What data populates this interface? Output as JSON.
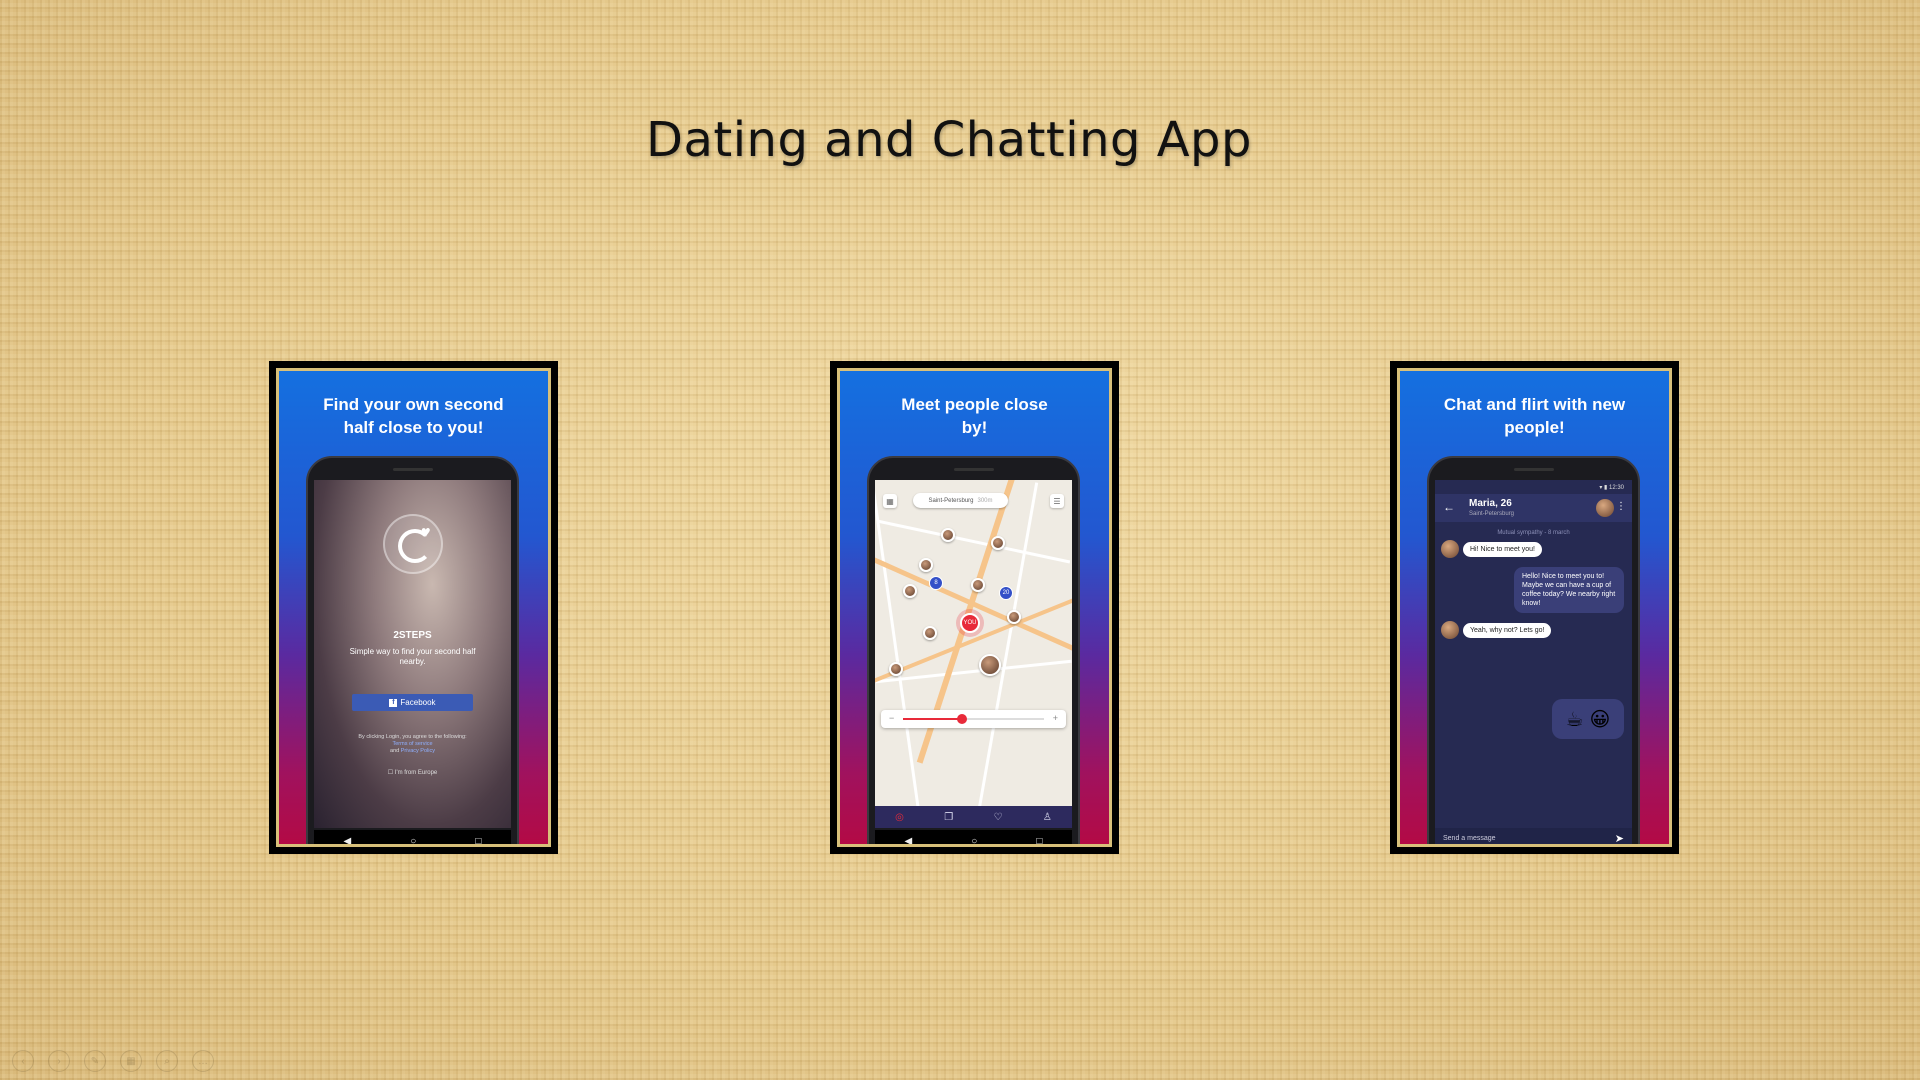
{
  "slide": {
    "title": "Dating and Chatting App"
  },
  "panel1": {
    "heading": "Find your own second half close to you!",
    "brand": "2STEPS",
    "tagline": "Simple way to find your second half nearby.",
    "facebook_button": "Facebook",
    "legal_text": "By clicking Login, you agree to the following:",
    "terms_link": "Terms of service",
    "and_text": "and",
    "privacy_link": "Privacy Policy",
    "europe_checkbox": "I'm from Europe"
  },
  "panel2": {
    "heading": "Meet people close by!",
    "city": "Saint-Petersburg",
    "city_distance": "300m",
    "you_label": "YOU",
    "cluster_counts": [
      "8",
      "20"
    ],
    "zoom_level": 0.42,
    "zoom_minus": "−",
    "zoom_plus": "+"
  },
  "panel3": {
    "heading": "Chat and flirt with new people!",
    "status_time": "12:30",
    "contact_name": "Maria, 26",
    "contact_city": "Saint-Petersburg",
    "day_separator": "Mutual sympathy - 8 march",
    "messages": [
      {
        "text": "Hi! Nice to meet you!"
      },
      {
        "text": "Hello! Nice to meet you to! Maybe we can have a cup of coffee today? We nearby right know!"
      },
      {
        "text": "Yeah, why not? Lets go!"
      }
    ],
    "emoji": [
      "☕",
      "😀"
    ],
    "composer_placeholder": "Send a message"
  },
  "nav_glyphs": {
    "back": "◀",
    "home": "○",
    "recent": "□"
  },
  "colors": {
    "background": "#e7cd92",
    "frame": "#000000",
    "frame_border": "#d8c07a",
    "gradient_top": "#1470e0",
    "gradient_bottom": "#b30a45",
    "accent_red": "#e82a3a",
    "facebook_blue": "#3b5bb5",
    "chat_bg": "#262a52"
  }
}
